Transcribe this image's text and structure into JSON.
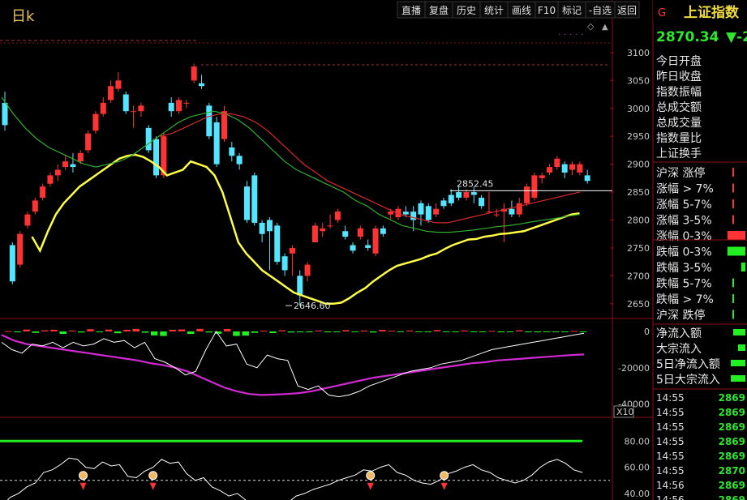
{
  "chart_label": "日k",
  "toolbar": [
    "直播",
    "复盘",
    "历史",
    "统计",
    "画线",
    "F10",
    "标记",
    "-自选",
    "返回"
  ],
  "header": {
    "marker": "G",
    "index_name": "上证指数",
    "price": "2870.34",
    "change_prefix": "▼-2"
  },
  "annotations": {
    "high_label": "2852.45",
    "low_label": "2646.60"
  },
  "colors": {
    "up": "#ff3333",
    "down": "#54e6ff",
    "ma_yellow": "#ffff44",
    "ma_green": "#2fae2f",
    "ma_red": "#d82a2a",
    "magenta": "#d22ad2",
    "grid": "#8b1010",
    "green": "#22ee22"
  },
  "info_labels": [
    "今日开盘",
    "昨日收盘",
    "指数振幅",
    "总成交额",
    "总成交量",
    "指数量比",
    "上证换手"
  ],
  "stats": [
    {
      "label": "沪深 涨停",
      "color": "#ff3333",
      "level": 0.02
    },
    {
      "label": "涨幅 > 7%",
      "color": "#ff3333",
      "level": 0.02
    },
    {
      "label": "涨幅 5-7%",
      "color": "#ff3333",
      "level": 0.02
    },
    {
      "label": "涨幅 3-5%",
      "color": "#ff3333",
      "level": 0.06
    },
    {
      "label": "涨幅 0-3%",
      "color": "#ff3333",
      "level": 0.85
    },
    {
      "label": "跌幅 0-3%",
      "color": "#22ee22",
      "level": 0.85
    },
    {
      "label": "跌幅 3-5%",
      "color": "#22ee22",
      "level": 0.2
    },
    {
      "label": "跌幅 5-7%",
      "color": "#22ee22",
      "level": 0.04
    },
    {
      "label": "跌幅 > 7%",
      "color": "#22ee22",
      "level": 0.02
    },
    {
      "label": "沪深 跌停",
      "color": "#22ee22",
      "level": 0.02
    }
  ],
  "flow": [
    {
      "label": "净流入额",
      "level": 0.25
    },
    {
      "label": "大宗流入",
      "level": 0.15
    },
    {
      "label": "5日净流入额",
      "level": 0.3
    },
    {
      "label": "5日大宗流入",
      "level": 0.3
    }
  ],
  "ticks": [
    {
      "time": "14:55",
      "value": "2869"
    },
    {
      "time": "14:55",
      "value": "2869"
    },
    {
      "time": "14:55",
      "value": "2869"
    },
    {
      "time": "14:55",
      "value": "2869"
    },
    {
      "time": "14:55",
      "value": "2869"
    },
    {
      "time": "14:55",
      "value": "2870"
    },
    {
      "time": "14:56",
      "value": "2869"
    },
    {
      "time": "14:56",
      "value": "2869"
    }
  ],
  "chart_data": [
    {
      "type": "candlestick",
      "title": "日k",
      "yticks": [
        3100,
        3050,
        3000,
        2950,
        2900,
        2850,
        2800,
        2750,
        2700,
        2650
      ],
      "ylim": [
        2625,
        3110
      ],
      "reference_line": 2852.45,
      "annotations": [
        {
          "text": "2852.45",
          "value": 2852.45
        },
        {
          "text": "2646.60",
          "value": 2646.6
        }
      ],
      "candles": [
        [
          3010,
          2970,
          3030,
          2960
        ],
        [
          2755,
          2690,
          2760,
          2685
        ],
        [
          2720,
          2775,
          2780,
          2715
        ],
        [
          2790,
          2810,
          2815,
          2785
        ],
        [
          2815,
          2835,
          2840,
          2810
        ],
        [
          2840,
          2860,
          2865,
          2835
        ],
        [
          2865,
          2880,
          2885,
          2860
        ],
        [
          2880,
          2890,
          2900,
          2870
        ],
        [
          2895,
          2905,
          2915,
          2890
        ],
        [
          2900,
          2895,
          2920,
          2885
        ],
        [
          2905,
          2920,
          2925,
          2900
        ],
        [
          2925,
          2955,
          2960,
          2920
        ],
        [
          2960,
          2990,
          2995,
          2955
        ],
        [
          2990,
          3010,
          3020,
          2985
        ],
        [
          3015,
          3040,
          3050,
          3010
        ],
        [
          3035,
          3050,
          3065,
          3030
        ],
        [
          3025,
          2995,
          3030,
          2990
        ],
        [
          2995,
          2995,
          3005,
          2965
        ],
        [
          2995,
          3005,
          3010,
          2985
        ],
        [
          2965,
          2925,
          2970,
          2920
        ],
        [
          2945,
          2880,
          2950,
          2875
        ],
        [
          2880,
          2950,
          2955,
          2875
        ],
        [
          3010,
          2995,
          3020,
          2985
        ],
        [
          2995,
          3015,
          3020,
          2990
        ],
        [
          3010,
          3010,
          3015,
          3000
        ],
        [
          3050,
          3075,
          3080,
          3045
        ],
        [
          3045,
          3040,
          3060,
          3035
        ],
        [
          3005,
          2950,
          3010,
          2945
        ],
        [
          2975,
          2900,
          2985,
          2895
        ],
        [
          2945,
          2995,
          3005,
          2940
        ],
        [
          2930,
          2915,
          2940,
          2905
        ],
        [
          2915,
          2900,
          2920,
          2890
        ],
        [
          2860,
          2800,
          2870,
          2795
        ],
        [
          2880,
          2795,
          2885,
          2790
        ],
        [
          2795,
          2775,
          2800,
          2760
        ],
        [
          2800,
          2780,
          2805,
          2710
        ],
        [
          2790,
          2725,
          2795,
          2720
        ],
        [
          2735,
          2710,
          2740,
          2700
        ],
        [
          2740,
          2750,
          2755,
          2700
        ],
        [
          2700,
          2665,
          2710,
          2646
        ],
        [
          2700,
          2720,
          2725,
          2690
        ],
        [
          2760,
          2790,
          2795,
          2760
        ],
        [
          2780,
          2785,
          2795,
          2770
        ],
        [
          2790,
          2790,
          2810,
          2785
        ],
        [
          2800,
          2815,
          2820,
          2795
        ],
        [
          2780,
          2770,
          2790,
          2765
        ],
        [
          2755,
          2745,
          2760,
          2740
        ],
        [
          2770,
          2785,
          2790,
          2765
        ],
        [
          2755,
          2750,
          2765,
          2745
        ],
        [
          2740,
          2785,
          2790,
          2735
        ],
        [
          2785,
          2775,
          2790,
          2770
        ],
        [
          2810,
          2815,
          2820,
          2800
        ],
        [
          2805,
          2820,
          2825,
          2800
        ],
        [
          2815,
          2810,
          2825,
          2805
        ],
        [
          2815,
          2800,
          2825,
          2780
        ],
        [
          2830,
          2810,
          2835,
          2790
        ],
        [
          2825,
          2800,
          2830,
          2795
        ],
        [
          2810,
          2820,
          2830,
          2805
        ],
        [
          2835,
          2825,
          2840,
          2820
        ],
        [
          2845,
          2830,
          2855,
          2825
        ],
        [
          2850,
          2840,
          2860,
          2835
        ],
        [
          2840,
          2850,
          2855,
          2835
        ],
        [
          2850,
          2845,
          2860,
          2830
        ],
        [
          2840,
          2825,
          2845,
          2820
        ],
        [
          2815,
          2815,
          2850,
          2812
        ],
        [
          2810,
          2810,
          2820,
          2805
        ],
        [
          2815,
          2820,
          2830,
          2760
        ],
        [
          2820,
          2810,
          2835,
          2805
        ],
        [
          2810,
          2830,
          2840,
          2805
        ],
        [
          2830,
          2860,
          2865,
          2825
        ],
        [
          2840,
          2880,
          2885,
          2835
        ],
        [
          2875,
          2880,
          2885,
          2865
        ],
        [
          2885,
          2895,
          2900,
          2880
        ],
        [
          2895,
          2910,
          2915,
          2890
        ],
        [
          2900,
          2885,
          2905,
          2875
        ],
        [
          2890,
          2900,
          2905,
          2880
        ],
        [
          2885,
          2900,
          2905,
          2880
        ],
        [
          2880,
          2870,
          2890,
          2865
        ]
      ],
      "series": [
        {
          "name": "",
          "color": "#ffff44",
          "values": [
            2770,
            2745,
            2780,
            2810,
            2830,
            2845,
            2860,
            2870,
            2880,
            2890,
            2900,
            2910,
            2915,
            2917,
            2913,
            2905,
            2895,
            2880,
            2885,
            2890,
            2905,
            2900,
            2895,
            2880,
            2850,
            2805,
            2760,
            2740,
            2725,
            2710,
            2700,
            2690,
            2680,
            2670,
            2665,
            2660,
            2655,
            2650,
            2650,
            2652,
            2660,
            2670,
            2678,
            2690,
            2700,
            2710,
            2718,
            2722,
            2726,
            2730,
            2736,
            2740,
            2748,
            2755,
            2760,
            2765,
            2766,
            2770,
            2772,
            2775,
            2776,
            2778,
            2780,
            2785,
            2790,
            2795,
            2800,
            2805,
            2810,
            2812
          ]
        },
        {
          "name": "",
          "color": "#2fae2f",
          "values": [
            3020,
            2990,
            2965,
            2945,
            2930,
            2920,
            2910,
            2900,
            2895,
            2900,
            2905,
            2915,
            2930,
            2945,
            2960,
            2975,
            2985,
            2990,
            2995,
            2990,
            2980,
            2965,
            2945,
            2925,
            2905,
            2890,
            2880,
            2870,
            2860,
            2850,
            2835,
            2825,
            2810,
            2800,
            2790,
            2785,
            2780,
            2778,
            2778,
            2780,
            2782,
            2785,
            2788,
            2790,
            2793,
            2797,
            2800,
            2803,
            2807,
            2810
          ]
        },
        {
          "name": "",
          "color": "#d82a2a",
          "values": [
            2950,
            2955,
            2965,
            2975,
            2985,
            2990,
            2990,
            2985,
            2975,
            2960,
            2940,
            2920,
            2900,
            2885,
            2870,
            2860,
            2850,
            2840,
            2830,
            2820,
            2810,
            2805,
            2800,
            2795,
            2795,
            2800,
            2805,
            2810,
            2815,
            2820,
            2825,
            2830,
            2835,
            2840,
            2845,
            2850
          ]
        }
      ]
    },
    {
      "type": "bar+line",
      "yticks": [
        0,
        -20000,
        -40000
      ],
      "ylim": [
        -46000,
        4000
      ],
      "series": [
        {
          "name": "",
          "color": "#d22ad2",
          "values": [
            -2000,
            -5000,
            -7000,
            -8000,
            -9000,
            -10000,
            -11000,
            -12000,
            -13000,
            -14000,
            -15000,
            -16000,
            -17500,
            -18500,
            -20000,
            -22000,
            -25000,
            -28000,
            -31000,
            -33000,
            -34500,
            -35000,
            -34800,
            -34500,
            -34000,
            -33000,
            -31500,
            -30000,
            -28500,
            -27000,
            -25500,
            -24500,
            -23500,
            -22500,
            -21500,
            -20500,
            -19500,
            -18500,
            -17500,
            -17000,
            -16000,
            -15500,
            -15000,
            -14500,
            -14000,
            -13500,
            -13000,
            -12700
          ]
        },
        {
          "name": "",
          "color": "#ffffff",
          "values": [
            -6000,
            -10000,
            -12000,
            -7000,
            -8000,
            -6000,
            -9000,
            -6000,
            -8000,
            -7000,
            -4000,
            -6000,
            -5000,
            -9000,
            -6000,
            -15000,
            -17000,
            -20000,
            -24000,
            -22000,
            -10000,
            0,
            -8000,
            -7000,
            -18000,
            -20000,
            -13000,
            -15000,
            -16000,
            -30000,
            -32000,
            -30000,
            -35000,
            -36000,
            -35000,
            -33000,
            -30000,
            -28000,
            -26000,
            -24000,
            -22000,
            -21000,
            -20000,
            -18000,
            -17000,
            -16000,
            -14000,
            -12000,
            -10000,
            -9000,
            -8000,
            -7000,
            -6000,
            -5000,
            -4000,
            -3000,
            -2000,
            -1000
          ]
        }
      ],
      "bars": [
        200,
        -500,
        1000,
        -800,
        600,
        900,
        -1400,
        500,
        -600,
        1200,
        -500,
        1000,
        -1000,
        900,
        1400,
        -700,
        -2200,
        -2500,
        900,
        1100,
        -1400,
        1400,
        -600,
        -1300,
        1300,
        -2500,
        -2300,
        -800,
        400,
        -900,
        600,
        -600,
        -500,
        -500,
        500,
        -500,
        -400,
        700,
        -300,
        500,
        -600,
        800,
        400,
        -300,
        500,
        -400,
        -300,
        700,
        -400,
        -300,
        500,
        -300,
        -300,
        300,
        -500,
        -400,
        600,
        -500,
        -500,
        -400,
        -300,
        -200,
        300,
        -400
      ]
    },
    {
      "type": "line",
      "yticks": [
        80,
        60,
        40
      ],
      "ylim": [
        35,
        95
      ],
      "threshold_label": "X10",
      "series": [
        {
          "name": "",
          "color": "#22ee22",
          "values": [
            80,
            80
          ]
        },
        {
          "name": "",
          "color": "#ffffff",
          "values": [
            30,
            37,
            40,
            45,
            48,
            56,
            58,
            62,
            67,
            66,
            60,
            59,
            64,
            61,
            62,
            53,
            52,
            57,
            60,
            66,
            63,
            64,
            55,
            50,
            52,
            45,
            42,
            38,
            40,
            35,
            30,
            28,
            28,
            30,
            33,
            38,
            40,
            43,
            45,
            47,
            50,
            52,
            54,
            58,
            57,
            60,
            62,
            56,
            54,
            50,
            48,
            47,
            50,
            55,
            57,
            60,
            62,
            58,
            56,
            52,
            50,
            48,
            50,
            54,
            60,
            64,
            66,
            63,
            58,
            56
          ]
        }
      ],
      "signals": [
        21,
        39,
        95,
        114
      ]
    }
  ]
}
